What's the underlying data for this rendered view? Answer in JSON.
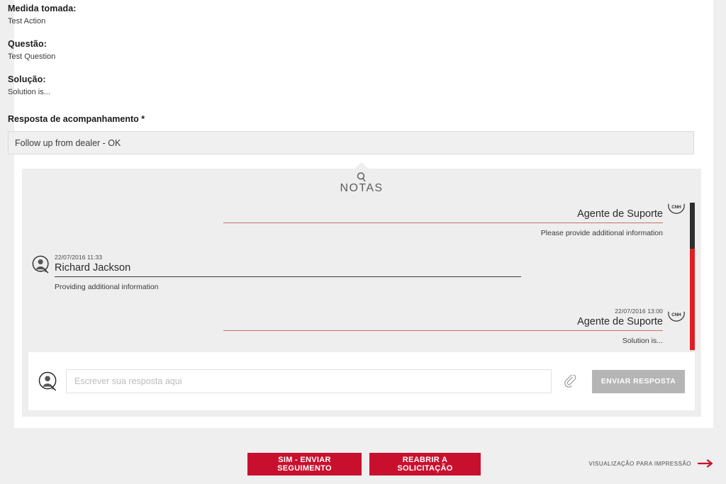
{
  "details": {
    "fields": [
      {
        "label": "Medida tomada:",
        "value": "Test Action"
      },
      {
        "label": "Questão:",
        "value": "Test Question"
      },
      {
        "label": "Solução:",
        "value": "Solution is..."
      }
    ],
    "followup": {
      "label": "Resposta de acompanhamento *",
      "value": "Follow up from dealer - OK"
    }
  },
  "notes": {
    "title": "NOTAS",
    "icon": "magnifier-icon",
    "entries": [
      {
        "author": "Agente de Suporte",
        "time": "",
        "body": "Please provide additional information",
        "side": "agent",
        "avatar": "cnh-logo-icon"
      },
      {
        "author": "Richard Jackson",
        "time": "22/07/2016 11:33",
        "body": "Providing additional information",
        "side": "user",
        "avatar": "person-avatar-icon"
      },
      {
        "author": "Agente de Suporte",
        "time": "22/07/2016 13:00",
        "body": "Solution is...",
        "side": "agent",
        "avatar": "cnh-logo-icon"
      }
    ],
    "reply": {
      "placeholder": "Escrever sua resposta aqui",
      "value": "",
      "attach_icon": "paperclip-icon",
      "send_label": "ENVIAR RESPOSTA"
    }
  },
  "footer": {
    "primary_label": "SIM - ENVIAR SEGUIMENTO",
    "secondary_label": "REABRIR A SOLICITAÇÃO",
    "print_label": "VISUALIZAÇÃO PARA IMPRESSÃO",
    "print_icon": "arrow-right-icon"
  },
  "colors": {
    "brand_red": "#c8102e",
    "scroll_red": "#e01f22",
    "agent_rule": "#c4706d",
    "disabled_gray": "#b5b5b5"
  }
}
